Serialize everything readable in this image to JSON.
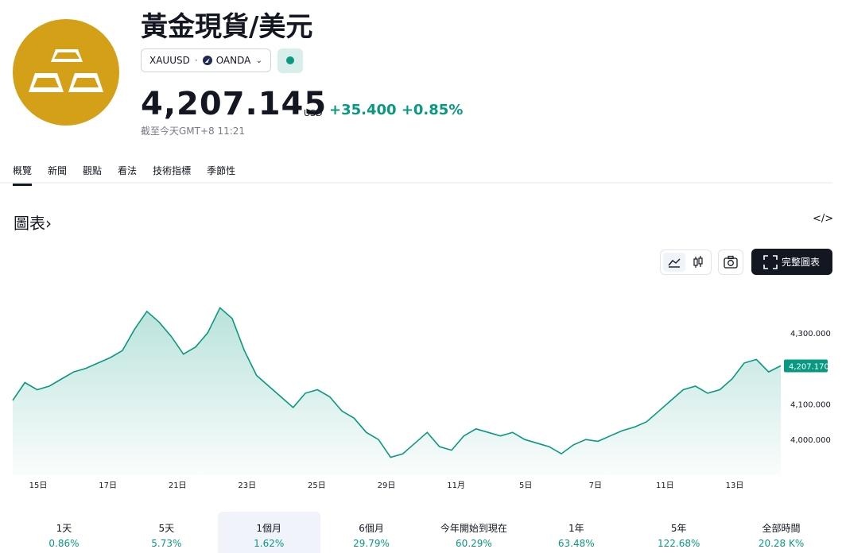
{
  "header": {
    "title": "黃金現貨/美元",
    "symbol": "XAUUSD",
    "separator": "·",
    "broker": "OANDA",
    "price": "4,207.145",
    "currency": "USD",
    "change": "+35.400",
    "change_pct": "+0.85%",
    "timestamp": "截至今天GMT+8 11:21",
    "logo_icon": "gold-bars-icon",
    "market_status_icon": "market-open-dot-icon"
  },
  "tabs": [
    {
      "label": "概覽",
      "active": true
    },
    {
      "label": "新聞"
    },
    {
      "label": "觀點"
    },
    {
      "label": "看法"
    },
    {
      "label": "技術指標"
    },
    {
      "label": "季節性"
    }
  ],
  "chart_section": {
    "title": "圖表",
    "title_arrow": "›",
    "embed_label": "</>",
    "full_chart_label": "完整圖表"
  },
  "chart_data": {
    "type": "area",
    "x_tick_labels": [
      "15日",
      "17日",
      "21日",
      "23日",
      "25日",
      "29日",
      "11月",
      "5日",
      "7日",
      "11日",
      "13日"
    ],
    "y_tick_labels": [
      "4,300.000",
      "4,100.000",
      "4,000.000"
    ],
    "ylim": [
      3900,
      4420
    ],
    "last_value_label": "4,207.170",
    "series": [
      {
        "values": [
          4110,
          4160,
          4140,
          4150,
          4170,
          4190,
          4200,
          4215,
          4230,
          4250,
          4310,
          4360,
          4330,
          4290,
          4240,
          4260,
          4300,
          4370,
          4340,
          4250,
          4180,
          4150,
          4120,
          4090,
          4130,
          4140,
          4120,
          4080,
          4060,
          4020,
          4000,
          3950,
          3960,
          3990,
          4020,
          3980,
          3970,
          4010,
          4030,
          4020,
          4010,
          4020,
          4000,
          3990,
          3980,
          3960,
          3985,
          4000,
          3995,
          4010,
          4025,
          4035,
          4050,
          4080,
          4110,
          4140,
          4150,
          4130,
          4140,
          4170,
          4215,
          4225,
          4190,
          4207
        ]
      }
    ],
    "line_color": "#089981",
    "grid": false
  },
  "periods": [
    {
      "label": "1天",
      "value": "0.86%"
    },
    {
      "label": "5天",
      "value": "5.73%"
    },
    {
      "label": "1個月",
      "value": "1.62%",
      "selected": true
    },
    {
      "label": "6個月",
      "value": "29.79%"
    },
    {
      "label": "今年開始到現在",
      "value": "60.29%"
    },
    {
      "label": "1年",
      "value": "63.48%"
    },
    {
      "label": "5年",
      "value": "122.68%"
    },
    {
      "label": "全部時間",
      "value": "20.28 K%"
    }
  ]
}
